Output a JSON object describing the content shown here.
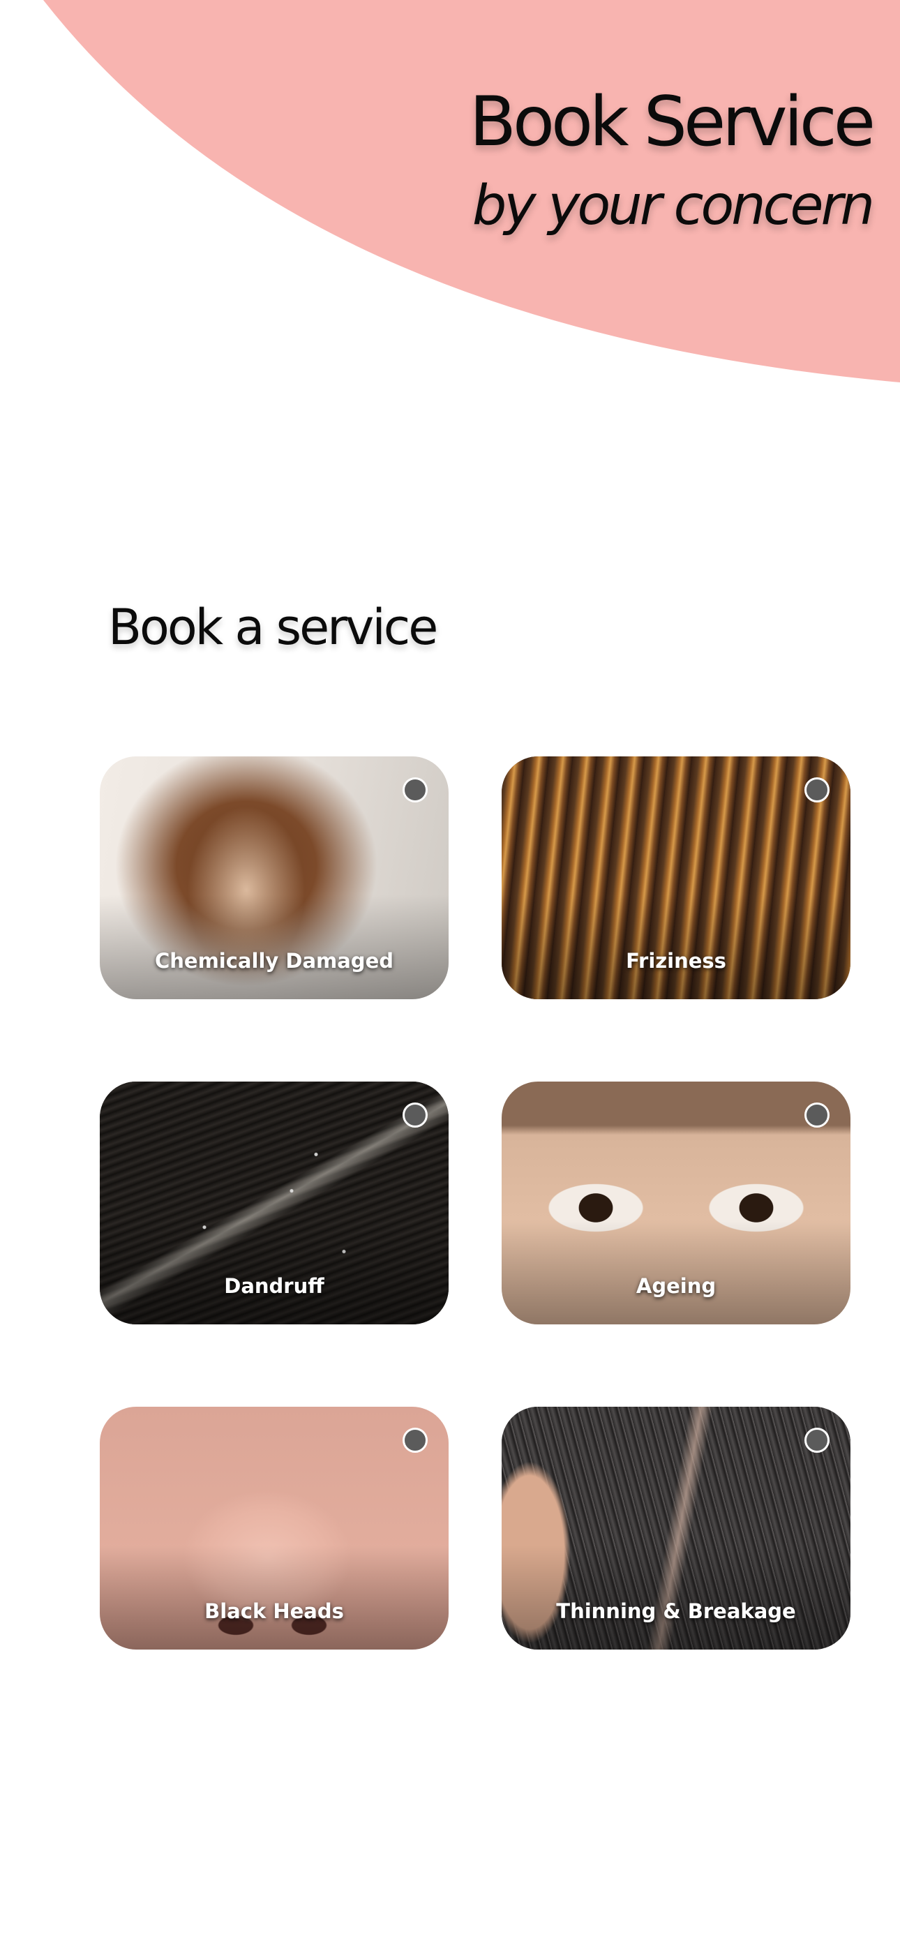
{
  "header": {
    "title": "Book Service",
    "subtitle": "by your concern"
  },
  "section": {
    "title": "Book a service"
  },
  "services": [
    {
      "label": "Chemically Damaged",
      "selected": false
    },
    {
      "label": "Friziness",
      "selected": false
    },
    {
      "label": "Dandruff",
      "selected": false
    },
    {
      "label": "Ageing",
      "selected": false
    },
    {
      "label": "Black Heads",
      "selected": false
    },
    {
      "label": "Thinning & Breakage",
      "selected": false
    }
  ],
  "colors": {
    "hero_blob": "#f8b4b0",
    "text": "#0b0b0b",
    "radio": "#5b5b5b",
    "card_label": "#ffffff"
  }
}
